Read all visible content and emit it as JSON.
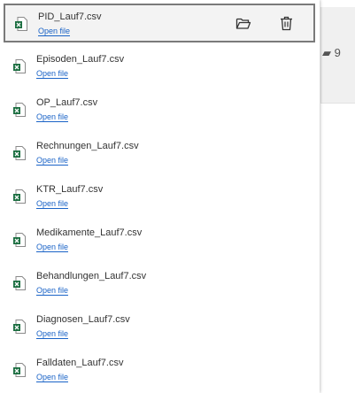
{
  "files": [
    {
      "name": "PID_Lauf7.csv",
      "link": "Open file",
      "selected": true
    },
    {
      "name": "Episoden_Lauf7.csv",
      "link": "Open file"
    },
    {
      "name": "OP_Lauf7.csv",
      "link": "Open file"
    },
    {
      "name": "Rechnungen_Lauf7.csv",
      "link": "Open file"
    },
    {
      "name": "KTR_Lauf7.csv",
      "link": "Open file"
    },
    {
      "name": "Medikamente_Lauf7.csv",
      "link": "Open file"
    },
    {
      "name": "Behandlungen_Lauf7.csv",
      "link": "Open file"
    },
    {
      "name": "Diagnosen_Lauf7.csv",
      "link": "Open file"
    },
    {
      "name": "Falldaten_Lauf7.csv",
      "link": "Open file"
    }
  ],
  "actions": {
    "open_folder_icon": "folder-open-icon",
    "delete_icon": "trash-icon"
  },
  "background": {
    "glyphs": "▰ 9"
  },
  "colors": {
    "link": "#1a63c7",
    "excel_green": "#1d6f42",
    "selected_border": "#7a7a7a",
    "selected_bg": "#f3f3f3"
  }
}
